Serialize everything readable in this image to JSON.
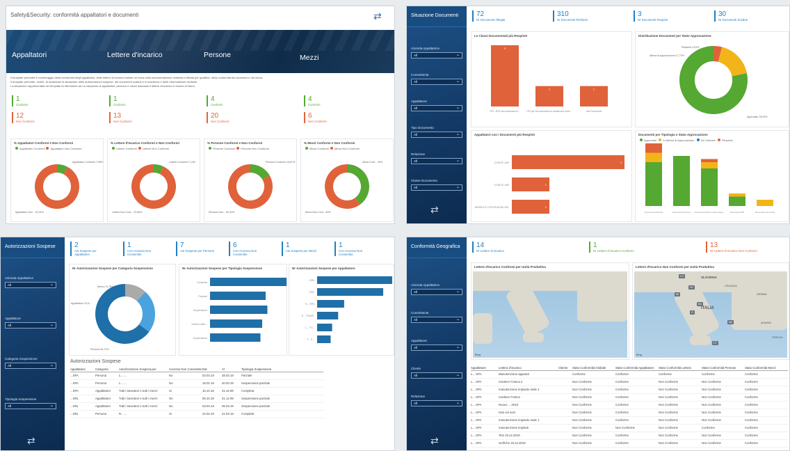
{
  "panel1": {
    "title": "Safety&Security: conformità appaltatori e documenti",
    "hero": [
      "Appaltatori",
      "Lettere d'incarico",
      "Persone",
      "Mezzi"
    ],
    "para_lines": [
      "Il template permette il monitoraggio della conformità degli appaltatori, delle lettere di incarico tramite un focus sulla documentazione richiesta e filtrata per qualifica, della conformità dei lavoratori e dei mezzi.",
      "Il template permette, inoltre, di analizzare la situazione delle autorizzazioni sospese, dei documenti scaduti e in scadenza e delle riformulazioni richieste.",
      "La situazione rappresentata nel template fa riferimento ad un campione di appaltatori, persone e mezzi associati a lettere d'incarico in essere al futuro."
    ],
    "kpis": [
      {
        "conf": "1",
        "conf_lbl": "Conformi",
        "nc": "12",
        "nc_lbl": "Non Conformi"
      },
      {
        "conf": "1",
        "conf_lbl": "Conformi",
        "nc": "13",
        "nc_lbl": "Non Conformi"
      },
      {
        "conf": "4",
        "conf_lbl": "Conformi",
        "nc": "20",
        "nc_lbl": "Non Conformi"
      },
      {
        "conf": "4",
        "conf_lbl": "Conformi",
        "nc": "6",
        "nc_lbl": "Non Conformi"
      }
    ],
    "donuts": [
      {
        "title": "% Appaltatori Conformi e Non Conformi",
        "l1": "Appaltatori Conformi",
        "l2": "Appaltatori Non Conformi",
        "lab_conf": "Appaltatori Conformi 7,69%",
        "lab_nc": "Appaltatori Non... 92,31%",
        "pct_conf": 7.69
      },
      {
        "title": "% Lettere d'Incarico Conformi e Non Conformi",
        "l1": "Lettere Conformi",
        "l2": "Lettere Non Conformi",
        "lab_conf": "Lettere Conformi 7,14%",
        "lab_nc": "Lettere Non Conf... 92,86%",
        "pct_conf": 7.14
      },
      {
        "title": "% Persone Conformi e Non Conformi",
        "l1": "Persone Conformi",
        "l2": "Persone Non Conformi",
        "lab_conf": "Persone Conformi 16,67%",
        "lab_nc": "Persone Non... 83,33%",
        "pct_conf": 16.67
      },
      {
        "title": "% Mezzi Conformi e Non Conformi",
        "l1": "Mezzi Conformi",
        "l2": "Mezzi Non Conformi",
        "lab_conf": "Mezzi Conf... 40%",
        "lab_nc": "Mezzi Non Conf... 60%",
        "pct_conf": 40
      }
    ],
    "colors": {
      "green": "#55a832",
      "red": "#e0623a"
    }
  },
  "panel2": {
    "side_title": "Situazione Documenti",
    "slicers": [
      {
        "label": "Azienda Appaltatrice",
        "value": "All"
      },
      {
        "label": "Committente",
        "value": "All"
      },
      {
        "label": "Appaltatore",
        "value": "All"
      },
      {
        "label": "Tipo Documento",
        "value": "All"
      },
      {
        "label": "Relazione",
        "value": "All"
      },
      {
        "label": "Classe Documento",
        "value": "All"
      }
    ],
    "cards": [
      {
        "num": "72",
        "lbl": "Nr Documenti Allegati"
      },
      {
        "num": "310",
        "lbl": "Nr Documenti Richiesti"
      },
      {
        "num": "3",
        "lbl": "Nr Documenti Respinti"
      },
      {
        "num": "30",
        "lbl": "Nr Documenti Scaduti"
      }
    ],
    "bar_top_title": "Le Classi Documentali più Respinte",
    "bar_top": {
      "values": [
        3,
        1,
        1
      ],
      "labels": [
        "DPI / DVR documentazione...",
        "DPI per documentazione valutazione rischi...",
        "Altri Documenti"
      ]
    },
    "donut_title": "Distribuzione Documenti per Stato Approvazione",
    "donut_labels": [
      "Respinto 4,03%",
      "Attesa di Approvazione 17,72%",
      "Approvato 78,25%"
    ],
    "hbar_title": "Appaltatori con i Documenti più Respinti",
    "hbar": {
      "values": [
        3,
        1,
        1
      ],
      "labels": [
        "CODICE 1AR",
        "CODICE 1AR",
        "ARREDI E COSTRUZIONI SRL"
      ]
    },
    "stack_title": "Documenti per Tipologia e Stato Approvazione",
    "stack_legend": [
      "Approvato",
      "In Attesa di Approvazione",
      "Da Caricare",
      "Respinto"
    ],
    "stack_cats": [
      "Documenti Azienda",
      "Documenti Persone",
      "Documenti Mezzi / Attrezzature",
      "Documenti DPI",
      "Documenti Sicurezza"
    ]
  },
  "panel3": {
    "side_title": "Autorizzazioni Sospese",
    "slicers": [
      {
        "label": "Azienda Appaltatrice",
        "value": "All"
      },
      {
        "label": "Appaltatore",
        "value": "All"
      },
      {
        "label": "Categoria Sospensione",
        "value": "All"
      },
      {
        "label": "Tipologia Sospensione",
        "value": "All"
      }
    ],
    "cards": [
      {
        "num": "2",
        "lbl": "Aut Sospese per Appaltatore"
      },
      {
        "num": "1",
        "lbl": "Con Accesso Non Consentito"
      },
      {
        "num": "7",
        "lbl": "Aut Sospese per Persone"
      },
      {
        "num": "6",
        "lbl": "Con Accesso Non Consentito"
      },
      {
        "num": "1",
        "lbl": "Aut Sospese per Mezzi"
      },
      {
        "num": "1",
        "lbl": "Con Accesso Non Consentito"
      }
    ],
    "donut_title": "Nr Autorizzazioni Sospese per Categoria Sospensione",
    "donut_labels": [
      "Mezzo 11,76%",
      "Appaltatore 23,5...",
      "Persona 64,71%"
    ],
    "hbar1_title": "Nr Autorizzazioni Sospese per Tipologia Sospensione",
    "hbar1": {
      "labels": [
        "Completa",
        "Parziale",
        "Sospensione",
        "Verifica dello...",
        "Sospensione"
      ],
      "values": [
        4.4,
        3.2,
        3.3,
        3.0,
        2.9
      ]
    },
    "hbar2_title": "Nr Autorizzazioni Sospese per Appaltatore",
    "hbar2": {
      "labels": [
        "...SPA",
        "...SRL",
        "S... SPA",
        "E... TRASF.",
        "L... TV...",
        "T... S..."
      ],
      "values": [
        5,
        4.4,
        1.8,
        1.4,
        1,
        0.9
      ]
    },
    "table_title": "Autorizzazioni Sospese",
    "table_cols": [
      "Appaltatore",
      "Categoria",
      "Autorizzazione Sospesa per",
      "Accesso Non Consentito",
      "Dal",
      "Al",
      "Tipologia Sospensione"
    ],
    "table_rows": [
      [
        "...SPA",
        "Persona",
        "L... ...",
        "No",
        "03.03.19",
        "28.03.19",
        "Parziale"
      ],
      [
        "...SPA",
        "Persona",
        "L... ...",
        "No",
        "18.02.19",
        "20.03.19",
        "Sospensione parziale"
      ],
      [
        "...SPA",
        "Appaltatore",
        "Tutti i lavoratori e tutti i mezzi",
        "Si",
        "15.10.18",
        "31.12.99",
        "Completa"
      ],
      [
        "...SRL",
        "Appaltatore",
        "Tutti i lavoratori e tutti i mezzi",
        "No",
        "05.10.19",
        "31.12.99",
        "Sospensione parziale"
      ],
      [
        "...SRL",
        "Appaltatore",
        "Tutti i lavoratori e tutti i mezzi",
        "No",
        "03.03.19",
        "05.03.19",
        "Sospensione parziale"
      ],
      [
        "...SRL",
        "Persona",
        "R... ...",
        "Si",
        "22.02.19",
        "21.03.19",
        "Completa"
      ]
    ]
  },
  "panel4": {
    "side_title": "Conformità Geografica",
    "slicers": [
      {
        "label": "Azienda Appaltatrice",
        "value": "All"
      },
      {
        "label": "Committente",
        "value": "All"
      },
      {
        "label": "Appaltatore",
        "value": "All"
      },
      {
        "label": "Cliente",
        "value": "All"
      },
      {
        "label": "Relazione",
        "value": "All"
      }
    ],
    "cards": [
      {
        "num": "14",
        "lbl": "Nr Lettere di Incarico"
      },
      {
        "num": "1",
        "lbl": "Nr Lettere di Incarico Conformi"
      },
      {
        "num": "13",
        "lbl": "Nr Lettere di Incarico Non Conformi"
      }
    ],
    "map1_title": "Lettere d'Incarico Conformi per Unità Produttiva",
    "map2_title": "Lettere d'Incarico Non Conformi per Unità Produttiva",
    "map_labels": [
      "SLOVENIA",
      "CROAZIA",
      "SERBIA",
      "ITALIA",
      "ALBANIA",
      "GRECIA"
    ],
    "bing": "Bing",
    "table_cols": [
      "Appaltatore",
      "Lettera d'incarico",
      "Cliente",
      "Stato Conformità Globale",
      "Stato Conformità Appaltatore",
      "Stato Conformità Lettera",
      "Stato Conformità Persone",
      "Stato Conformità Mezzi"
    ],
    "table_rows": [
      [
        "L... SPA",
        "Manutenzione apparati",
        "",
        "Conforme",
        "Conforme",
        "Conforme",
        "Conforme",
        "Conforme"
      ],
      [
        "L... SPA",
        "Cantiere Franca 2",
        "",
        "Non Conforme",
        "Conforme",
        "Non Conforme",
        "Non Conforme",
        "Conforme"
      ],
      [
        "L... SPA",
        "manutenzione impianto sede 2",
        "",
        "Non Conforme",
        "Conforme",
        "Non Conforme",
        "Non Conforme",
        "Conforme"
      ],
      [
        "L... SPA",
        "Cantiere Franca",
        "",
        "Non Conforme",
        "Conforme",
        "Non Conforme",
        "Non Conforme",
        "Conforme"
      ],
      [
        "L... SPA",
        "Nuovo ... 2019",
        "",
        "Non Conforme",
        "Conforme",
        "Non Conforme",
        "Non Conforme",
        "Conforme"
      ],
      [
        "L... SPA",
        "Ivan soi sost",
        "",
        "Non Conforme",
        "Conforme",
        "Non Conforme",
        "Non Conforme",
        "Conforme"
      ],
      [
        "L... SPA",
        "manutenzione impianto sede 1",
        "",
        "Non Conforme",
        "Conforme",
        "Non Conforme",
        "Non Conforme",
        "Conforme"
      ],
      [
        "L... SPA",
        "manutenzione impianti",
        "",
        "Non Conforme",
        "Non Conforme",
        "Non Conforme",
        "Conforme",
        "Conforme"
      ],
      [
        "L... SPA",
        "Test 19.12.2019",
        "",
        "Non Conforme",
        "Conforme",
        "Non Conforme",
        "Non Conforme",
        "Conforme"
      ],
      [
        "L... SPA",
        "verifiche 19.12.2019",
        "",
        "Non Conforme",
        "Conforme",
        "Non Conforme",
        "Non Conforme",
        "Conforme"
      ]
    ]
  }
}
